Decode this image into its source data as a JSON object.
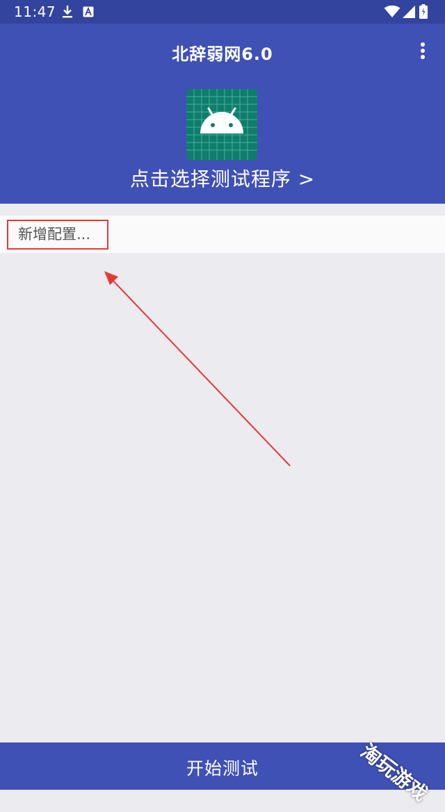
{
  "status_bar": {
    "time": "11:47",
    "icons": [
      "download-icon",
      "notification-a-icon",
      "wifi-icon",
      "signal-icon",
      "battery-icon"
    ]
  },
  "header": {
    "title": "北辞弱网6.0",
    "menu_icon": "more-vert-icon",
    "app_icon": "android-icon",
    "choose_label": "点击选择测试程序 >"
  },
  "config": {
    "add_label": "新增配置..."
  },
  "bottom": {
    "start_label": "开始测试"
  },
  "watermark": {
    "text": "淘玩游戏"
  },
  "colors": {
    "primary": "#3F51B5",
    "status_bar": "#33449E",
    "background": "#EBEBF0",
    "highlight": "#E53935",
    "icon_bg": "#107D6C"
  }
}
